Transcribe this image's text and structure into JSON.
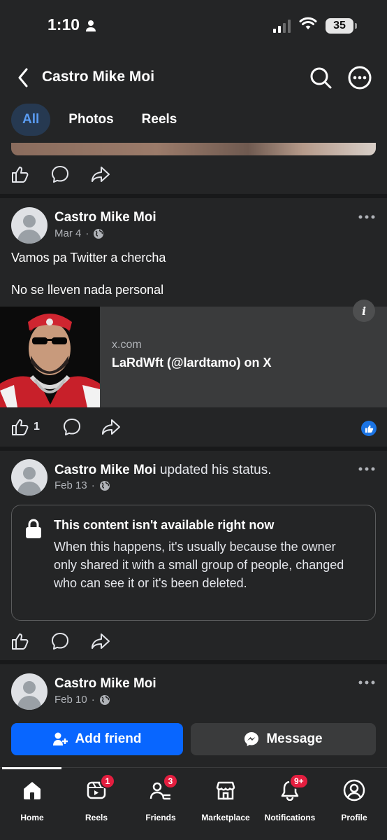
{
  "status_bar": {
    "time": "1:10",
    "battery": "35"
  },
  "header": {
    "title": "Castro Mike Moi"
  },
  "tabs": [
    {
      "label": "All",
      "active": true
    },
    {
      "label": "Photos",
      "active": false
    },
    {
      "label": "Reels",
      "active": false
    }
  ],
  "posts": [
    {
      "author": "Castro Mike Moi",
      "date": "Mar 4",
      "text_lines": [
        "Vamos pa Twitter a chercha",
        "No se lleven nada personal"
      ],
      "link_preview": {
        "domain": "x.com",
        "title": "LaRdWft (@lardtamo) on X"
      },
      "like_count": "1"
    },
    {
      "author": "Castro Mike Moi",
      "action": "updated his status.",
      "date": "Feb 13",
      "unavailable": {
        "title": "This content isn't available right now",
        "body": "When this happens, it's usually because the owner only shared it with a small group of people, changed who can see it or it's been deleted."
      }
    },
    {
      "author": "Castro Mike Moi",
      "date": "Feb 10"
    }
  ],
  "buttons": {
    "add_friend": "Add friend",
    "message": "Message"
  },
  "tabbar": [
    {
      "label": "Home",
      "icon": "home-icon",
      "badge": ""
    },
    {
      "label": "Reels",
      "icon": "reels-icon",
      "badge": "1"
    },
    {
      "label": "Friends",
      "icon": "friends-icon",
      "badge": "3"
    },
    {
      "label": "Marketplace",
      "icon": "marketplace-icon",
      "badge": ""
    },
    {
      "label": "Notifications",
      "icon": "bell-icon",
      "badge": "9+"
    },
    {
      "label": "Profile",
      "icon": "profile-icon",
      "badge": ""
    }
  ],
  "colors": {
    "accent": "#0866ff",
    "badge": "#e41e3f",
    "background": "#242526",
    "tab_active_text": "#5a9cf2"
  }
}
